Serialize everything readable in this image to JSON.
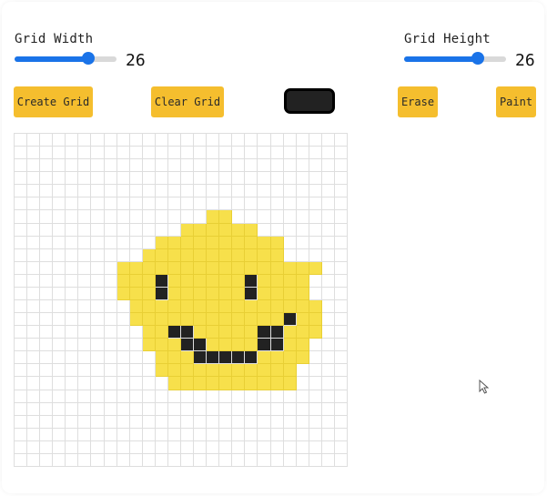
{
  "controls": {
    "grid_width": {
      "label": "Grid Width",
      "value": "26",
      "fraction": 0.72
    },
    "grid_height": {
      "label": "Grid Height",
      "value": "26",
      "fraction": 0.72
    }
  },
  "buttons": {
    "create": "Create Grid",
    "clear": "Clear Grid",
    "erase": "Erase",
    "paint": "Paint"
  },
  "colors": {
    "accent": "#1a73e8",
    "button": "#f5be2e",
    "selected_paint": "#222222",
    "yellow": "#f7e04b",
    "black": "#222222",
    "grid_line": "#dedede"
  },
  "grid": {
    "cols": 26,
    "rows": 26,
    "rows_data": [
      "..........................",
      "..........................",
      "..........................",
      "..........................",
      "..........................",
      "..........................",
      "...............YY.........",
      ".............YYYYYY.......",
      "...........YYYYYYYYYY.....",
      "..........YYYYYYYYYYY.....",
      "........YYYYYYYYYYYYYYYY..",
      "........YYYBYYYYYYBYYYY...",
      "........YYYBYYYYYYBYYYY...",
      ".........YYYYYYYYYYYYYYY..",
      ".........YYYYYYYYYYYYBYY..",
      "..........YYBBYYYYYBBYYY..",
      "..........YYYBBYYYYBBYY...",
      "...........YYYBBBBBYYYY...",
      "...........YYYYYYYYYYY....",
      "............YYYYYYYYYY....",
      "..........................",
      "..........................",
      "..........................",
      "..........................",
      "..........................",
      ".........................."
    ]
  }
}
